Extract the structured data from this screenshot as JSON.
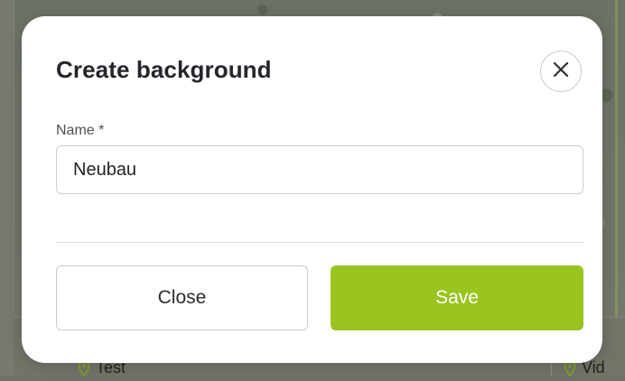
{
  "dialog": {
    "title": "Create background",
    "close_icon": "close-icon",
    "name_field": {
      "label": "Name *",
      "value": "Neubau"
    },
    "close_button_label": "Close",
    "save_button_label": "Save"
  },
  "background_page": {
    "list_item_left": "Test",
    "list_item_right": "Vid",
    "pin_icon": "location-pin-icon"
  },
  "colors": {
    "accent": "#9ac420",
    "overlay": "#707467",
    "text": "#23262a"
  }
}
